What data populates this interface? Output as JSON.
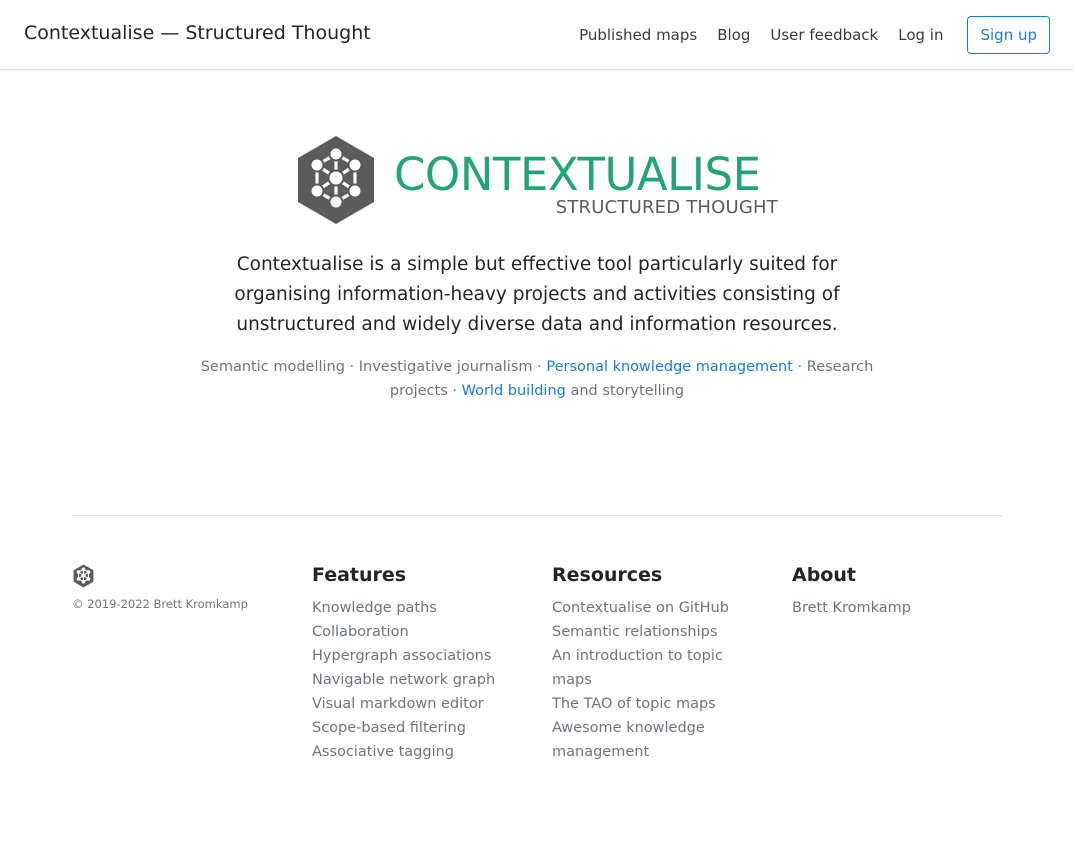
{
  "nav": {
    "brand": "Contextualise — Structured Thought",
    "links": [
      "Published maps",
      "Blog",
      "User feedback",
      "Log in"
    ],
    "signup_label": "Sign up"
  },
  "hero": {
    "logo_word": "CONTEXTUALISE",
    "logo_tagline": "STRUCTURED THOUGHT",
    "lead": "Contextualise is a simple but effective tool particularly suited for organising information-heavy projects and activities consisting of unstructured and widely diverse data and information resources.",
    "tags": {
      "part1": "Semantic modelling · Investigative journalism · ",
      "link1": "Personal knowledge management",
      "part2": " · Research projects · ",
      "link2": "World building",
      "part3": " and storytelling"
    }
  },
  "footer": {
    "copyright": "© 2019-2022 Brett Kromkamp",
    "columns": [
      {
        "title": "Features",
        "items": [
          "Knowledge paths",
          "Collaboration",
          "Hypergraph associations",
          "Navigable network graph",
          "Visual markdown editor",
          "Scope-based filtering",
          "Associative tagging"
        ]
      },
      {
        "title": "Resources",
        "items": [
          "Contextualise on GitHub",
          "Semantic relationships",
          "An introduction to topic maps",
          "The TAO of topic maps",
          "Awesome knowledge management"
        ]
      },
      {
        "title": "About",
        "items": [
          "Brett Kromkamp"
        ]
      }
    ]
  },
  "colors": {
    "accent": "#1a7ad9",
    "logo_green": "#23a37a",
    "logo_gray": "#5e5a59",
    "muted": "#6c757d"
  },
  "icons": {
    "logo_mark": "contextualise-hexagon-network-icon"
  }
}
